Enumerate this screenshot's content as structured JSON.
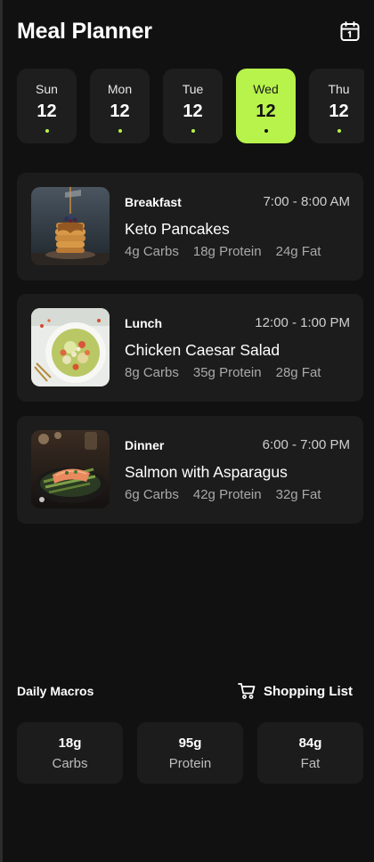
{
  "header": {
    "title": "Meal Planner",
    "calendar_icon": "calendar-icon"
  },
  "days": [
    {
      "name": "Sun",
      "date": "12"
    },
    {
      "name": "Mon",
      "date": "12"
    },
    {
      "name": "Tue",
      "date": "12"
    },
    {
      "name": "Wed",
      "date": "12",
      "selected": true
    },
    {
      "name": "Thu",
      "date": "12"
    }
  ],
  "meals": [
    {
      "type": "Breakfast",
      "time": "7:00 - 8:00 AM",
      "name": "Keto Pancakes",
      "carbs": "4g Carbs",
      "protein": "18g Protein",
      "fat": "24g Fat"
    },
    {
      "type": "Lunch",
      "time": "12:00 - 1:00 PM",
      "name": "Chicken Caesar Salad",
      "carbs": "8g Carbs",
      "protein": "35g Protein",
      "fat": "28g Fat"
    },
    {
      "type": "Dinner",
      "time": "6:00 - 7:00 PM",
      "name": "Salmon with Asparagus",
      "carbs": "6g Carbs",
      "protein": "42g Protein",
      "fat": "32g Fat"
    }
  ],
  "summary": {
    "label": "Daily Macros",
    "shopping_label": "Shopping List",
    "shopping_icon": "cart-icon"
  },
  "totals": [
    {
      "value": "18g",
      "name": "Carbs"
    },
    {
      "value": "95g",
      "name": "Protein"
    },
    {
      "value": "84g",
      "name": "Fat"
    }
  ],
  "colors": {
    "accent": "#b7f34b",
    "background": "#111111",
    "card": "#1c1c1c"
  }
}
